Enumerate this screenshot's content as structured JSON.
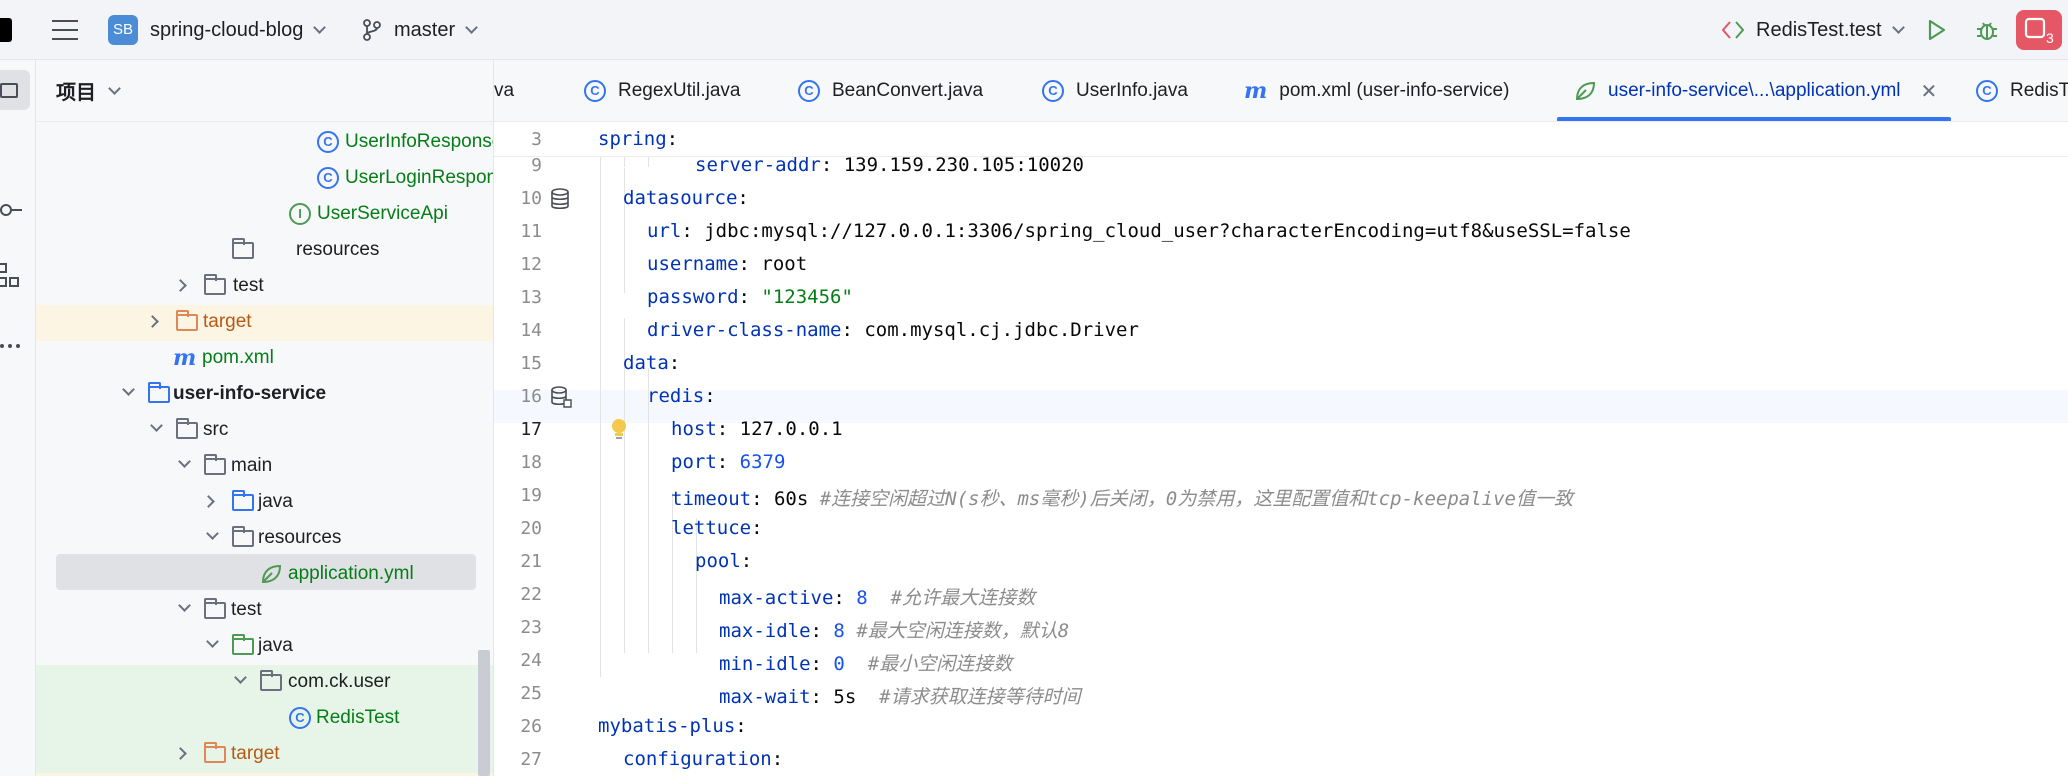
{
  "titlebar": {
    "project_badge": "SB",
    "project_name": "spring-cloud-blog",
    "branch": "master",
    "run_config": "RedisTest.test"
  },
  "project_panel": {
    "title": "项目",
    "rows": [
      {
        "label": "UserInfoResponse"
      },
      {
        "label": "UserLoginRespon"
      },
      {
        "label": "UserServiceApi"
      },
      {
        "label": "resources"
      },
      {
        "label": "test"
      },
      {
        "label": "target"
      },
      {
        "label": "pom.xml"
      },
      {
        "label": "user-info-service"
      },
      {
        "label": "src"
      },
      {
        "label": "main"
      },
      {
        "label": "java"
      },
      {
        "label": "resources"
      },
      {
        "label": "application.yml"
      },
      {
        "label": "test"
      },
      {
        "label": "java"
      },
      {
        "label": "com.ck.user"
      },
      {
        "label": "RedisTest"
      },
      {
        "label": "target"
      }
    ]
  },
  "tabs": [
    {
      "label": "va"
    },
    {
      "label": "RegexUtil.java"
    },
    {
      "label": "BeanConvert.java"
    },
    {
      "label": "UserInfo.java"
    },
    {
      "label": "pom.xml (user-info-service)"
    },
    {
      "label": "user-info-service\\...\\application.yml"
    },
    {
      "label": "RedisTe"
    }
  ],
  "editor": {
    "line_numbers": [
      "3",
      "9",
      "10",
      "11",
      "12",
      "13",
      "14",
      "15",
      "16",
      "17",
      "18",
      "19",
      "20",
      "21",
      "22",
      "23",
      "24",
      "25",
      "26",
      "27"
    ],
    "lines": [
      {
        "key": "spring",
        "sep": ":",
        "val": "",
        "str": "",
        "num": "",
        "comment": ""
      },
      {
        "key": "server-addr",
        "sep": ":",
        "val": " 139.159.230.105:10020",
        "str": "",
        "num": "",
        "comment": ""
      },
      {
        "key": "datasource",
        "sep": ":",
        "val": "",
        "str": "",
        "num": "",
        "comment": ""
      },
      {
        "key": "url",
        "sep": ":",
        "val": " jdbc:mysql://127.0.0.1:3306/spring_cloud_user?characterEncoding=utf8&useSSL=false",
        "str": "",
        "num": "",
        "comment": ""
      },
      {
        "key": "username",
        "sep": ":",
        "val": " root",
        "str": "",
        "num": "",
        "comment": ""
      },
      {
        "key": "password",
        "sep": ":",
        "val": " ",
        "str": "\"123456\"",
        "num": "",
        "comment": ""
      },
      {
        "key": "driver-class-name",
        "sep": ":",
        "val": " com.mysql.cj.jdbc.Driver",
        "str": "",
        "num": "",
        "comment": ""
      },
      {
        "key": "data",
        "sep": ":",
        "val": "",
        "str": "",
        "num": "",
        "comment": ""
      },
      {
        "key": "redis",
        "sep": ":",
        "val": "",
        "str": "",
        "num": "",
        "comment": ""
      },
      {
        "key": "host",
        "sep": ":",
        "val": " 127.0.0.1",
        "str": "",
        "num": "",
        "comment": ""
      },
      {
        "key": "port",
        "sep": ":",
        "val": " ",
        "str": "",
        "num": "6379",
        "comment": ""
      },
      {
        "key": "timeout",
        "sep": ":",
        "val": " 60s ",
        "str": "",
        "num": "",
        "comment": "#连接空闲超过N(s秒、ms毫秒)后关闭，0为禁用，这里配置值和tcp-keepalive值一致"
      },
      {
        "key": "lettuce",
        "sep": ":",
        "val": "",
        "str": "",
        "num": "",
        "comment": ""
      },
      {
        "key": "pool",
        "sep": ":",
        "val": "",
        "str": "",
        "num": "",
        "comment": ""
      },
      {
        "key": "max-active",
        "sep": ":",
        "val": " ",
        "str": "",
        "num": "8",
        "comment": "  #允许最大连接数"
      },
      {
        "key": "max-idle",
        "sep": ":",
        "val": " ",
        "str": "",
        "num": "8",
        "comment": " #最大空闲连接数，默认8"
      },
      {
        "key": "min-idle",
        "sep": ":",
        "val": " ",
        "str": "",
        "num": "0",
        "comment": "  #最小空闲连接数"
      },
      {
        "key": "max-wait",
        "sep": ":",
        "val": " 5s  ",
        "str": "",
        "num": "",
        "comment": "#请求获取连接等待时间"
      },
      {
        "key": "mybatis-plus",
        "sep": ":",
        "val": "",
        "str": "",
        "num": "",
        "comment": ""
      },
      {
        "key": "configuration",
        "sep": ":",
        "val": "",
        "str": "",
        "num": "",
        "comment": ""
      }
    ]
  },
  "colors": {
    "accent": "#3574f0",
    "keyword": "#0033b3",
    "string": "#067d17",
    "number": "#1750eb",
    "comment": "#8c8c8c",
    "tab_underline": "#3574f0",
    "stop_button": "#e55765"
  }
}
